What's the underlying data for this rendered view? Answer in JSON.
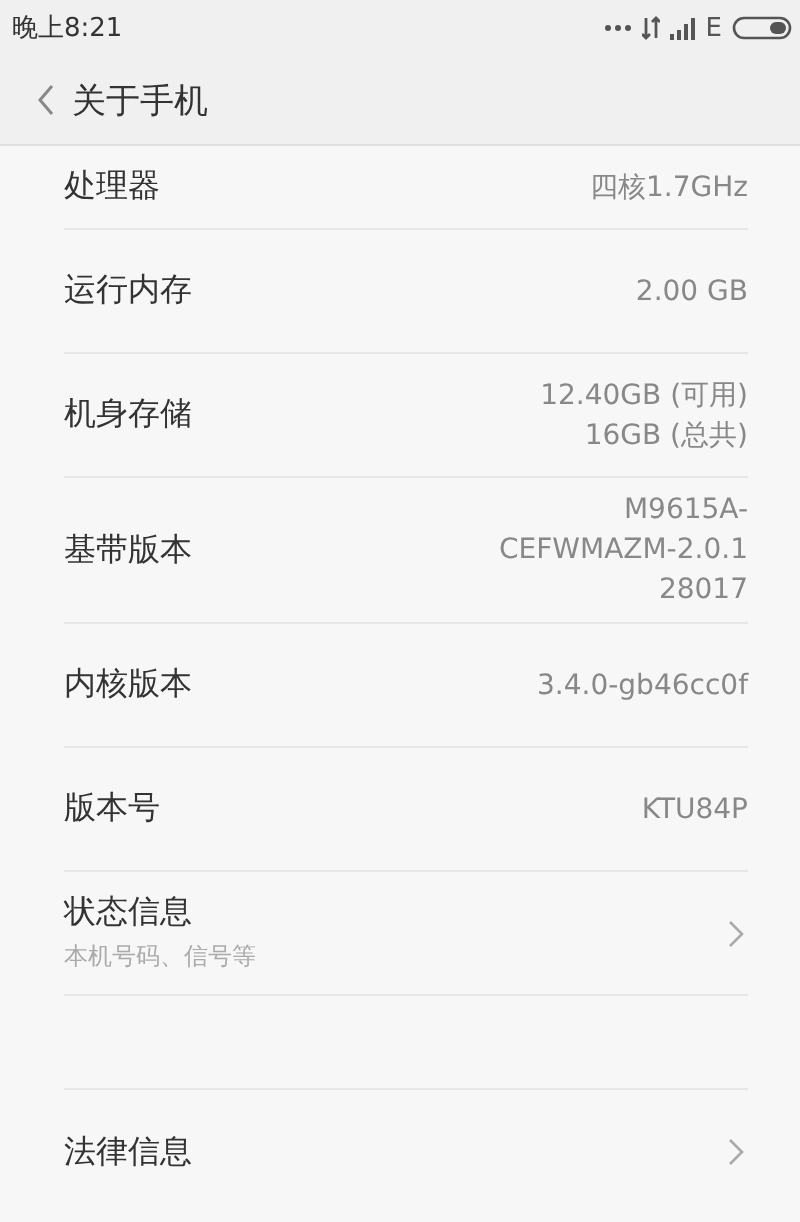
{
  "status_bar": {
    "time": "晚上8:21",
    "network_type": "E"
  },
  "header": {
    "title": "关于手机"
  },
  "groups": [
    {
      "items": [
        {
          "kind": "info",
          "label": "处理器",
          "value": [
            "四核1.7GHz"
          ]
        },
        {
          "kind": "info",
          "label": "运行内存",
          "value": [
            "2.00 GB"
          ]
        },
        {
          "kind": "info",
          "label": "机身存储",
          "value": [
            "12.40GB (可用)",
            "16GB (总共)"
          ]
        },
        {
          "kind": "info",
          "label": "基带版本",
          "value": [
            "M9615A-",
            "CEFWMAZM-2.0.1",
            "28017"
          ]
        },
        {
          "kind": "info",
          "label": "内核版本",
          "value": [
            "3.4.0-gb46cc0f"
          ]
        },
        {
          "kind": "info",
          "label": "版本号",
          "value": [
            "KTU84P"
          ]
        },
        {
          "kind": "link",
          "label": "状态信息",
          "subtitle": "本机号码、信号等"
        }
      ]
    },
    {
      "items": [
        {
          "kind": "link",
          "label": "法律信息"
        }
      ]
    }
  ]
}
